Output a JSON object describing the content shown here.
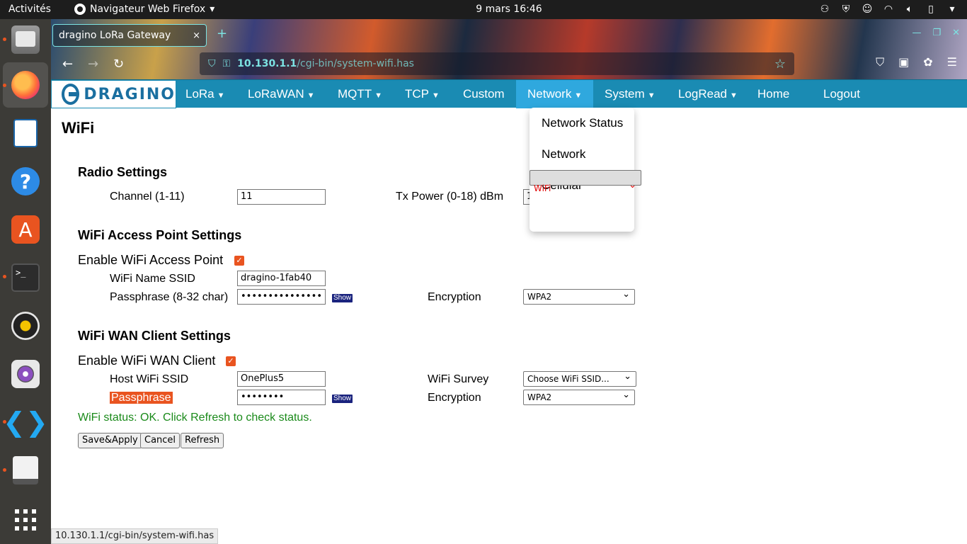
{
  "topbar": {
    "activities": "Activités",
    "app_name": "Navigateur Web Firefox",
    "app_caret": "▾",
    "clock": "9 mars  16:46"
  },
  "tray_icons": [
    "people-icon",
    "shield-icon",
    "discord-icon",
    "wifi-icon",
    "volume-icon",
    "battery-icon",
    "power-menu-icon"
  ],
  "dock_icons": [
    "files-icon",
    "firefox-icon",
    "writer-icon",
    "help-icon",
    "software-store-icon",
    "terminal-icon",
    "rhythmbox-icon",
    "cheese-icon",
    "vscode-icon",
    "document-viewer-icon",
    "show-apps-icon"
  ],
  "browser": {
    "tab_title": "dragino LoRa Gateway",
    "tab_close": "×",
    "new_tab": "+",
    "url_host": "10.130.1.1",
    "url_path": "/cgi-bin/system-wifi.has",
    "status_url": "10.130.1.1/cgi-bin/system-wifi.has"
  },
  "navbar": {
    "logo_text": "DRAGINO",
    "items": [
      {
        "label": "LoRa",
        "caret": "▼"
      },
      {
        "label": "LoRaWAN",
        "caret": "▼"
      },
      {
        "label": "MQTT",
        "caret": "▼"
      },
      {
        "label": "TCP",
        "caret": "▼"
      },
      {
        "label": "Custom"
      },
      {
        "label": "Network",
        "caret": "▼"
      },
      {
        "label": "System",
        "caret": "▼"
      },
      {
        "label": "LogRead",
        "caret": "▼"
      },
      {
        "label": "Home"
      },
      {
        "label": "Logout"
      }
    ],
    "active_color": "#2fa8de",
    "bar_color": "#1a8bb3"
  },
  "dropdown": {
    "items": [
      "Network Status",
      "Network",
      "WiFi",
      "Cellular"
    ],
    "selected": "WiFi"
  },
  "page": {
    "title": "WiFi",
    "radio": {
      "heading": "Radio Settings",
      "channel_label": "Channel (1-11)",
      "channel_value": "11",
      "txpower_label": "Tx Power (0-18) dBm",
      "txpower_value": "1"
    },
    "ap": {
      "heading": "WiFi Access Point Settings",
      "enable_label": "Enable WiFi Access Point",
      "enabled": true,
      "ssid_label": "WiFi Name SSID",
      "ssid_value": "dragino-1fab40",
      "pass_label": "Passphrase (8-32 char)",
      "pass_value": "•••••••••••••••",
      "show_label": "Show",
      "enc_label": "Encryption",
      "enc_value": "WPA2"
    },
    "wan": {
      "heading": "WiFi WAN Client Settings",
      "enable_label": "Enable WiFi WAN Client",
      "enabled": true,
      "ssid_label": "Host WiFi SSID",
      "ssid_value": "OnePlus5",
      "survey_label": "WiFi Survey",
      "survey_value": "Choose WiFi SSID...",
      "pass_label": "Passphrase",
      "pass_value": "••••••••",
      "show_label": "Show",
      "enc_label": "Encryption",
      "enc_value": "WPA2"
    },
    "status": "WiFi status: OK. Click Refresh to check status.",
    "buttons": {
      "save": "Save&Apply",
      "cancel": "Cancel",
      "refresh": "Refresh"
    }
  }
}
